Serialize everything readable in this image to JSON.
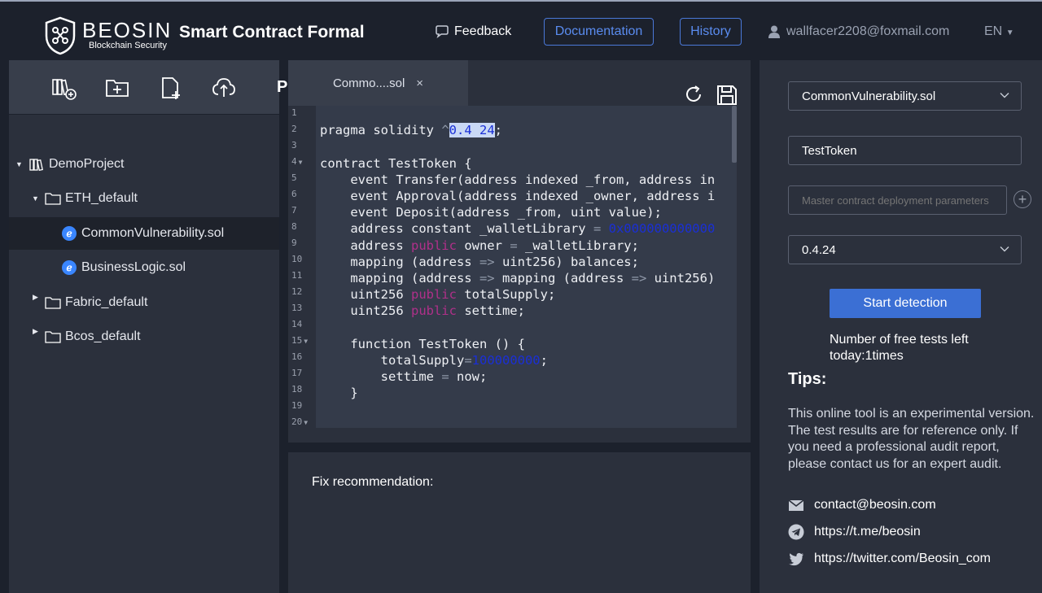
{
  "header": {
    "brand": "BEOSIN",
    "brand_sub": "Blockchain Security",
    "title": "Smart Contract Formal",
    "feedback": "Feedback",
    "documentation": "Documentation",
    "history": "History",
    "user_email": "wallfacer2208@foxmail.com",
    "language": "EN"
  },
  "sidebar": {
    "toolbar_icons": [
      "new-project-icon",
      "new-folder-icon",
      "new-file-icon",
      "upload-icon"
    ],
    "tree": [
      {
        "label": "DemoProject",
        "type": "project",
        "expanded": true
      },
      {
        "label": "ETH_default",
        "type": "folder",
        "expanded": true
      },
      {
        "label": "CommonVulnerability.sol",
        "type": "file",
        "selected": true
      },
      {
        "label": "BusinessLogic.sol",
        "type": "file"
      },
      {
        "label": "Fabric_default",
        "type": "folder",
        "expanded": false
      },
      {
        "label": "Bcos_default",
        "type": "folder",
        "expanded": false
      }
    ]
  },
  "editor": {
    "tab_label": "Commo....sol",
    "tab_close": "×",
    "tab_edge_text": "P",
    "line_numbers": [
      "1",
      "2",
      "3",
      "4",
      "5",
      "6",
      "7",
      "8",
      "9",
      "10",
      "11",
      "12",
      "13",
      "14",
      "15",
      "16",
      "17",
      "18",
      "19",
      "20"
    ]
  },
  "fix": {
    "title": "Fix recommendation:"
  },
  "right": {
    "contract_file": "CommonVulnerability.sol",
    "contract_name": "TestToken",
    "params_placeholder": "Master contract deployment parameters",
    "compiler_version": "0.4.24",
    "start_button": "Start detection",
    "free_tests": "Number of free tests left today:1times",
    "tips_title": "Tips:",
    "tips_text": "This online tool is an experimental version. The test results are for reference only. If you need a professional audit report, please contact us for an expert audit.",
    "contacts": [
      {
        "icon": "mail-icon",
        "text": "contact@beosin.com"
      },
      {
        "icon": "telegram-icon",
        "text": "https://t.me/beosin"
      },
      {
        "icon": "twitter-icon",
        "text": "https://twitter.com/Beosin_com"
      }
    ]
  },
  "colors": {
    "background": "#1c212c",
    "panel": "#2b303c",
    "accent": "#3b6fd4",
    "keyword": "#b0308a",
    "number": "#1a2fd6"
  }
}
